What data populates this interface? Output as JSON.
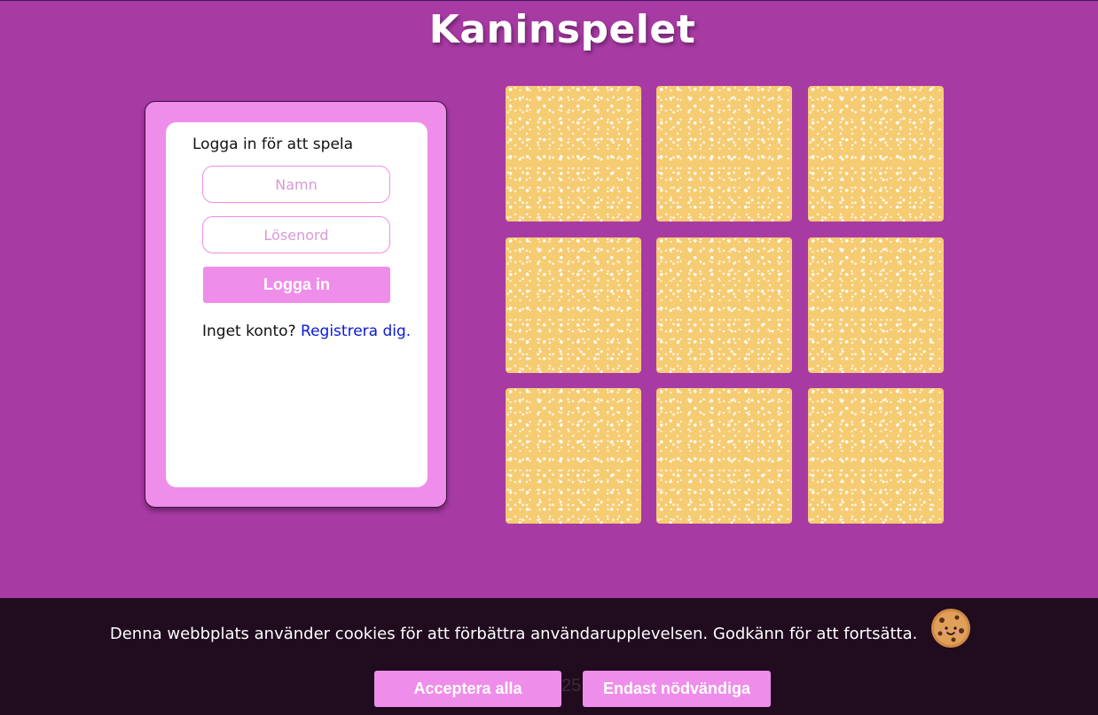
{
  "header": {
    "title": "Kaninspelet"
  },
  "login": {
    "heading": "Logga in för att spela",
    "name_placeholder": "Namn",
    "password_placeholder": "Lösenord",
    "submit_label": "Logga in",
    "no_account_text": "Inget konto?",
    "register_link": "Registrera dig."
  },
  "board": {
    "cards": [
      {
        "state": "face-down"
      },
      {
        "state": "face-down"
      },
      {
        "state": "face-down"
      },
      {
        "state": "face-down"
      },
      {
        "state": "face-down"
      },
      {
        "state": "face-down"
      },
      {
        "state": "face-down"
      },
      {
        "state": "face-down"
      },
      {
        "state": "face-down"
      }
    ]
  },
  "cookie_banner": {
    "message": "Denna webbplats använder cookies för att förbättra användarupplevelsen. Godkänn för att fortsätta.",
    "icon": "cookie-icon",
    "hidden_number": "25",
    "accept_all_label": "Acceptera alla",
    "necessary_only_label": "Endast nödvändiga"
  },
  "colors": {
    "background": "#a83aa4",
    "accent_pink": "#ef8dea",
    "card_back": "#f6cc73",
    "banner": "#200b1f",
    "link": "#0a18d8"
  }
}
